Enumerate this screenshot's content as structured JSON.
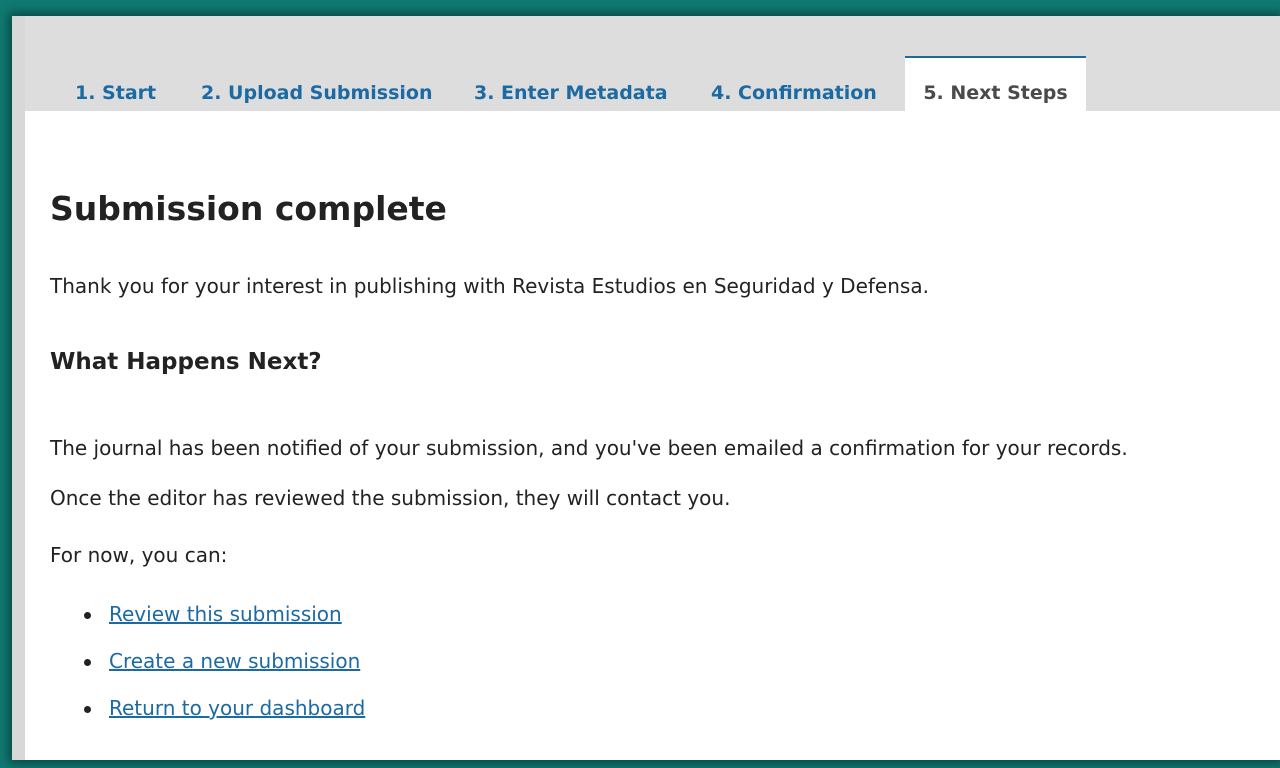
{
  "tabs": [
    {
      "label": "1. Start",
      "active": false
    },
    {
      "label": "2. Upload Submission",
      "active": false
    },
    {
      "label": "3. Enter Metadata",
      "active": false
    },
    {
      "label": "4. Confirmation",
      "active": false
    },
    {
      "label": "5. Next Steps",
      "active": true
    }
  ],
  "main": {
    "title": "Submission complete",
    "thanks": "Thank you for your interest in publishing with Revista Estudios en Seguridad y Defensa.",
    "next_heading": "What Happens Next?",
    "next_line1": "The journal has been notified of your submission, and you've been emailed a confirmation for your records.",
    "next_line2": "Once the editor has reviewed the submission, they will contact you.",
    "for_now": "For now, you can:",
    "actions": [
      {
        "label": "Review this submission"
      },
      {
        "label": "Create a new submission"
      },
      {
        "label": "Return to your dashboard"
      }
    ]
  },
  "colors": {
    "accent": "#1c6aa3",
    "frame_border": "#0f7a72",
    "tabbar_bg": "#dddddd"
  }
}
